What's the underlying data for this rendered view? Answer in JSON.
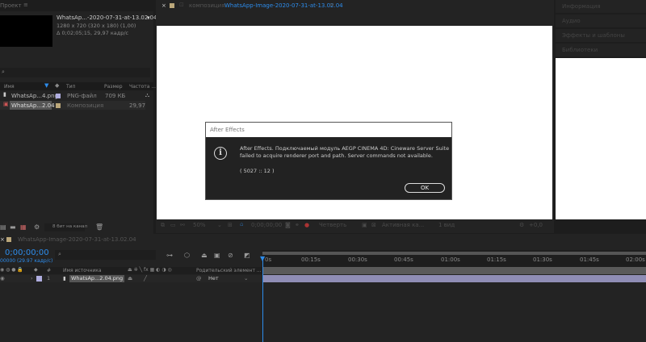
{
  "project": {
    "tab": "Проект",
    "menu_icon": "≡",
    "item_title": "WhatsAp...-2020-07-31-at-13.02.04",
    "item_res": "1280 x 720  (320 x 180) (1,00)",
    "item_duration": "Δ 0;02;05;15, 29,97 кадр/с",
    "search_placeholder": "⌕",
    "columns": [
      "Имя",
      "Тип",
      "Размер",
      "Частота ..."
    ],
    "rows": [
      {
        "name": "WhatsAp...4.png",
        "type": "PNG-файл",
        "size": "709 КБ",
        "rate": "",
        "color": "#b0aee0"
      },
      {
        "name": "WhatsAp...2.04",
        "type": "Композиция",
        "size": "",
        "rate": "29,97",
        "color": "#bba77a"
      }
    ],
    "bit_depth": "8 бит на канал"
  },
  "comp": {
    "close": "×",
    "label": "композиция",
    "name": "WhatsApp-Image-2020-07-31-at-13.02.04",
    "menu_icon": "≡",
    "toolbar": {
      "zoom": "50%",
      "timecode": "0;00;00;00",
      "resolution": "Четверть",
      "camera": "Активная ка...",
      "views": "1 вид",
      "exposure": "+0,0"
    }
  },
  "right_panel": {
    "items": [
      "Информация",
      "Аудио",
      "Эффекты и шаблоны",
      "Библиотеки"
    ]
  },
  "dialog": {
    "title": "After Effects",
    "line1": "After Effects. Подключаемый модуль AEGP CINEMA 4D: Cineware Server Suite",
    "line2": "failed to acquire renderer port and path. Server commands not available.",
    "code": "( 5027 :: 12 )",
    "ok": "OK"
  },
  "timeline": {
    "tab": "WhatsApp-Image-2020-07-31-at-13.02.04",
    "timecode": "0;00;00;00",
    "fps": "00000 (29.97 кадр/с)",
    "col_num": "#",
    "col_source": "Имя источника",
    "col_parent": "Родительский элемент ...",
    "layer": {
      "index": "1",
      "name": "WhatsAp...2.04.png",
      "parent": "Нет",
      "color": "#b0aee0"
    },
    "ruler": [
      "0s",
      "00:15s",
      "00:30s",
      "00:45s",
      "01:00s",
      "01:15s",
      "01:30s",
      "01:45s",
      "02:00s"
    ]
  }
}
